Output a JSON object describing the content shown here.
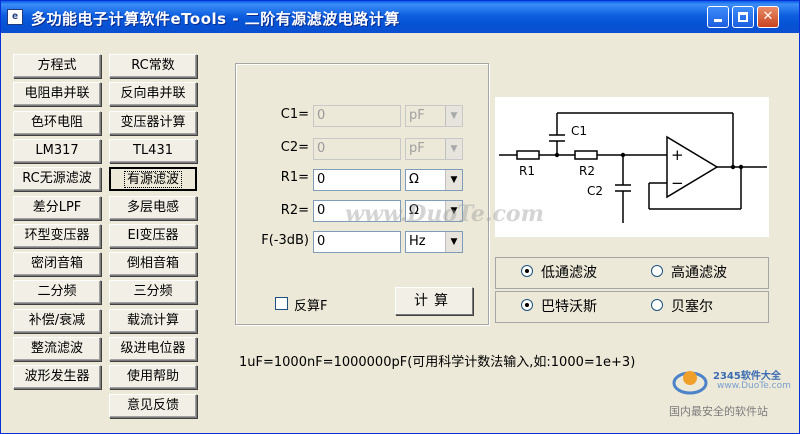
{
  "window": {
    "title": "多功能电子计算软件eTools - 二阶有源滤波电路计算",
    "icon_text": "e",
    "min_icon": "minimize-icon",
    "max_icon": "maximize-icon",
    "close_icon": "close-icon",
    "close_glyph": "✕"
  },
  "left_buttons": [
    {
      "label": "方程式"
    },
    {
      "label": "RC常数"
    },
    {
      "label": "电阻串并联"
    },
    {
      "label": "反向串并联"
    },
    {
      "label": "色环电阻"
    },
    {
      "label": "变压器计算"
    },
    {
      "label": "LM317"
    },
    {
      "label": "TL431"
    },
    {
      "label": "RC无源滤波"
    },
    {
      "label": "有源滤波"
    },
    {
      "label": "差分LPF"
    },
    {
      "label": "多层电感"
    },
    {
      "label": "环型变压器"
    },
    {
      "label": "EI变压器"
    },
    {
      "label": "密闭音箱"
    },
    {
      "label": "倒相音箱"
    },
    {
      "label": "二分频"
    },
    {
      "label": "三分频"
    },
    {
      "label": "补偿/衰减"
    },
    {
      "label": "载流计算"
    },
    {
      "label": "整流滤波"
    },
    {
      "label": "级进电位器"
    },
    {
      "label": "波形发生器"
    },
    {
      "label": "使用帮助"
    },
    {
      "label": "意见反馈"
    }
  ],
  "active_button": "有源滤波",
  "form": {
    "c1": {
      "label": "C1=",
      "value": "0",
      "unit": "pF"
    },
    "c2": {
      "label": "C2=",
      "value": "0",
      "unit": "pF"
    },
    "r1": {
      "label": "R1=",
      "value": "0",
      "unit": "Ω"
    },
    "r2": {
      "label": "R2=",
      "value": "0",
      "unit": "Ω"
    },
    "f": {
      "label": "F(-3dB)",
      "value": "0",
      "unit": "Hz"
    },
    "reverse_label": "反算F",
    "calc_label": "计算"
  },
  "diagram": {
    "c1": "C1",
    "c2": "C2",
    "r1": "R1",
    "r2": "R2",
    "plus": "+",
    "minus": "−"
  },
  "filter_type": {
    "low": "低通滤波",
    "high": "高通滤波",
    "selected": "低通滤波"
  },
  "filter_kind": {
    "butterworth": "巴特沃斯",
    "bessel": "贝塞尔",
    "selected": "巴特沃斯"
  },
  "note": "1uF=1000nF=1000000pF(可用科学计数法输入,如:1000=1e+3)",
  "watermarks": {
    "center": "www.DuoTe.com",
    "brand": "2345软件大全",
    "url": "www.DuoTe.com",
    "tagline": "国内最安全的软件站"
  }
}
